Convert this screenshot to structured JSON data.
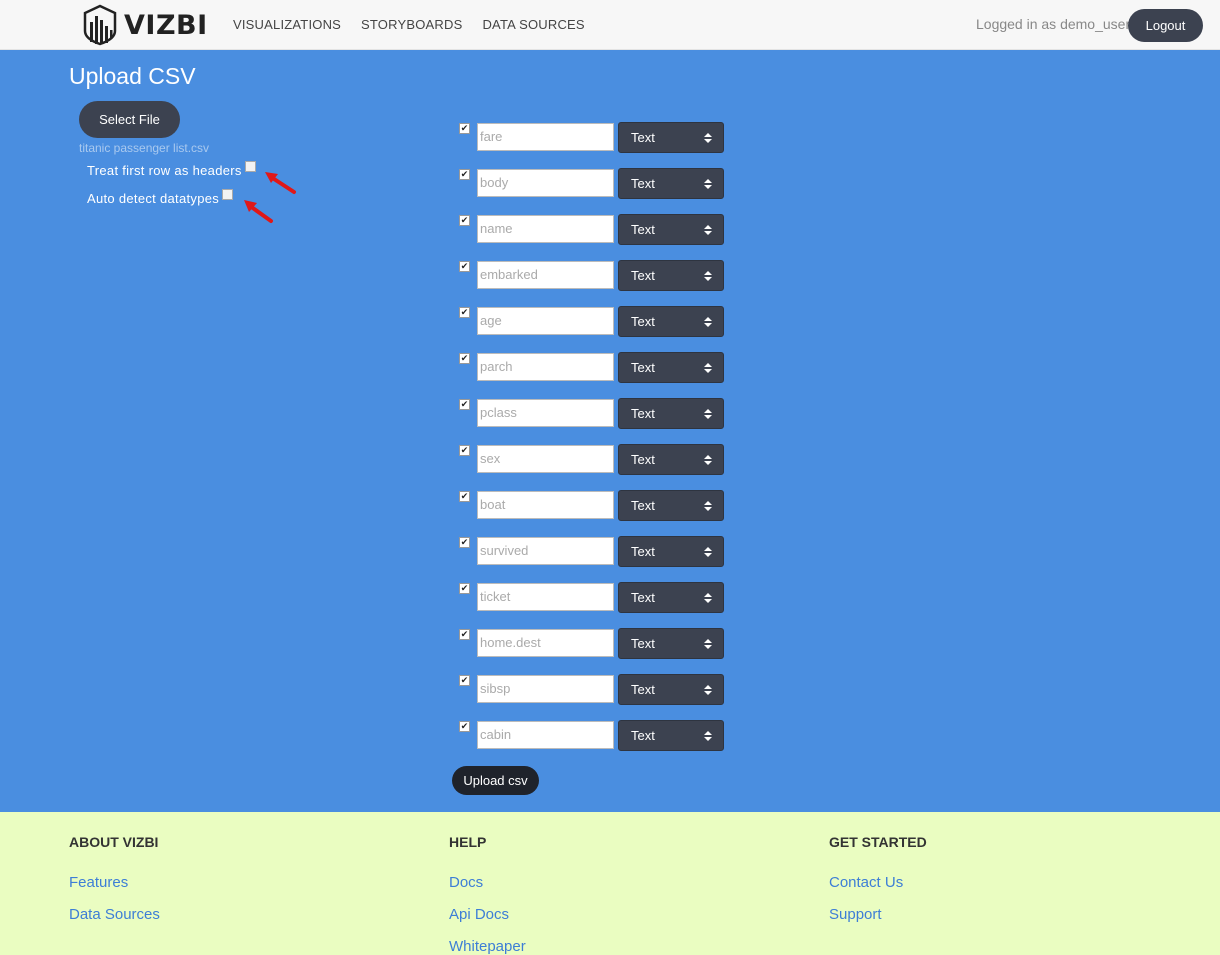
{
  "brand": {
    "name": "VIZBI"
  },
  "nav": [
    {
      "label": "VISUALIZATIONS"
    },
    {
      "label": "STORYBOARDS"
    },
    {
      "label": "DATA SOURCES"
    }
  ],
  "user": {
    "logged_text": "Logged in as demo_user",
    "logout_label": "Logout"
  },
  "page": {
    "title": "Upload CSV",
    "select_file_label": "Select File",
    "file_name": "titanic passenger list.csv",
    "options": [
      {
        "label": "Treat first row as headers",
        "checked": false
      },
      {
        "label": "Auto detect datatypes",
        "checked": false
      }
    ],
    "upload_label": "Upload csv",
    "accent_color": "#4a8ee0"
  },
  "columns": [
    {
      "name": "fare",
      "type": "Text",
      "checked": true
    },
    {
      "name": "body",
      "type": "Text",
      "checked": true
    },
    {
      "name": "name",
      "type": "Text",
      "checked": true
    },
    {
      "name": "embarked",
      "type": "Text",
      "checked": true
    },
    {
      "name": "age",
      "type": "Text",
      "checked": true
    },
    {
      "name": "parch",
      "type": "Text",
      "checked": true
    },
    {
      "name": "pclass",
      "type": "Text",
      "checked": true
    },
    {
      "name": "sex",
      "type": "Text",
      "checked": true
    },
    {
      "name": "boat",
      "type": "Text",
      "checked": true
    },
    {
      "name": "survived",
      "type": "Text",
      "checked": true
    },
    {
      "name": "ticket",
      "type": "Text",
      "checked": true
    },
    {
      "name": "home.dest",
      "type": "Text",
      "checked": true
    },
    {
      "name": "sibsp",
      "type": "Text",
      "checked": true
    },
    {
      "name": "cabin",
      "type": "Text",
      "checked": true
    }
  ],
  "footer": {
    "about": {
      "heading": "ABOUT VIZBI",
      "links": [
        "Features",
        "Data Sources"
      ]
    },
    "help": {
      "heading": "HELP",
      "links": [
        "Docs",
        "Api Docs",
        "Whitepaper"
      ]
    },
    "get_started": {
      "heading": "GET STARTED",
      "links": [
        "Contact Us",
        "Support"
      ]
    }
  }
}
